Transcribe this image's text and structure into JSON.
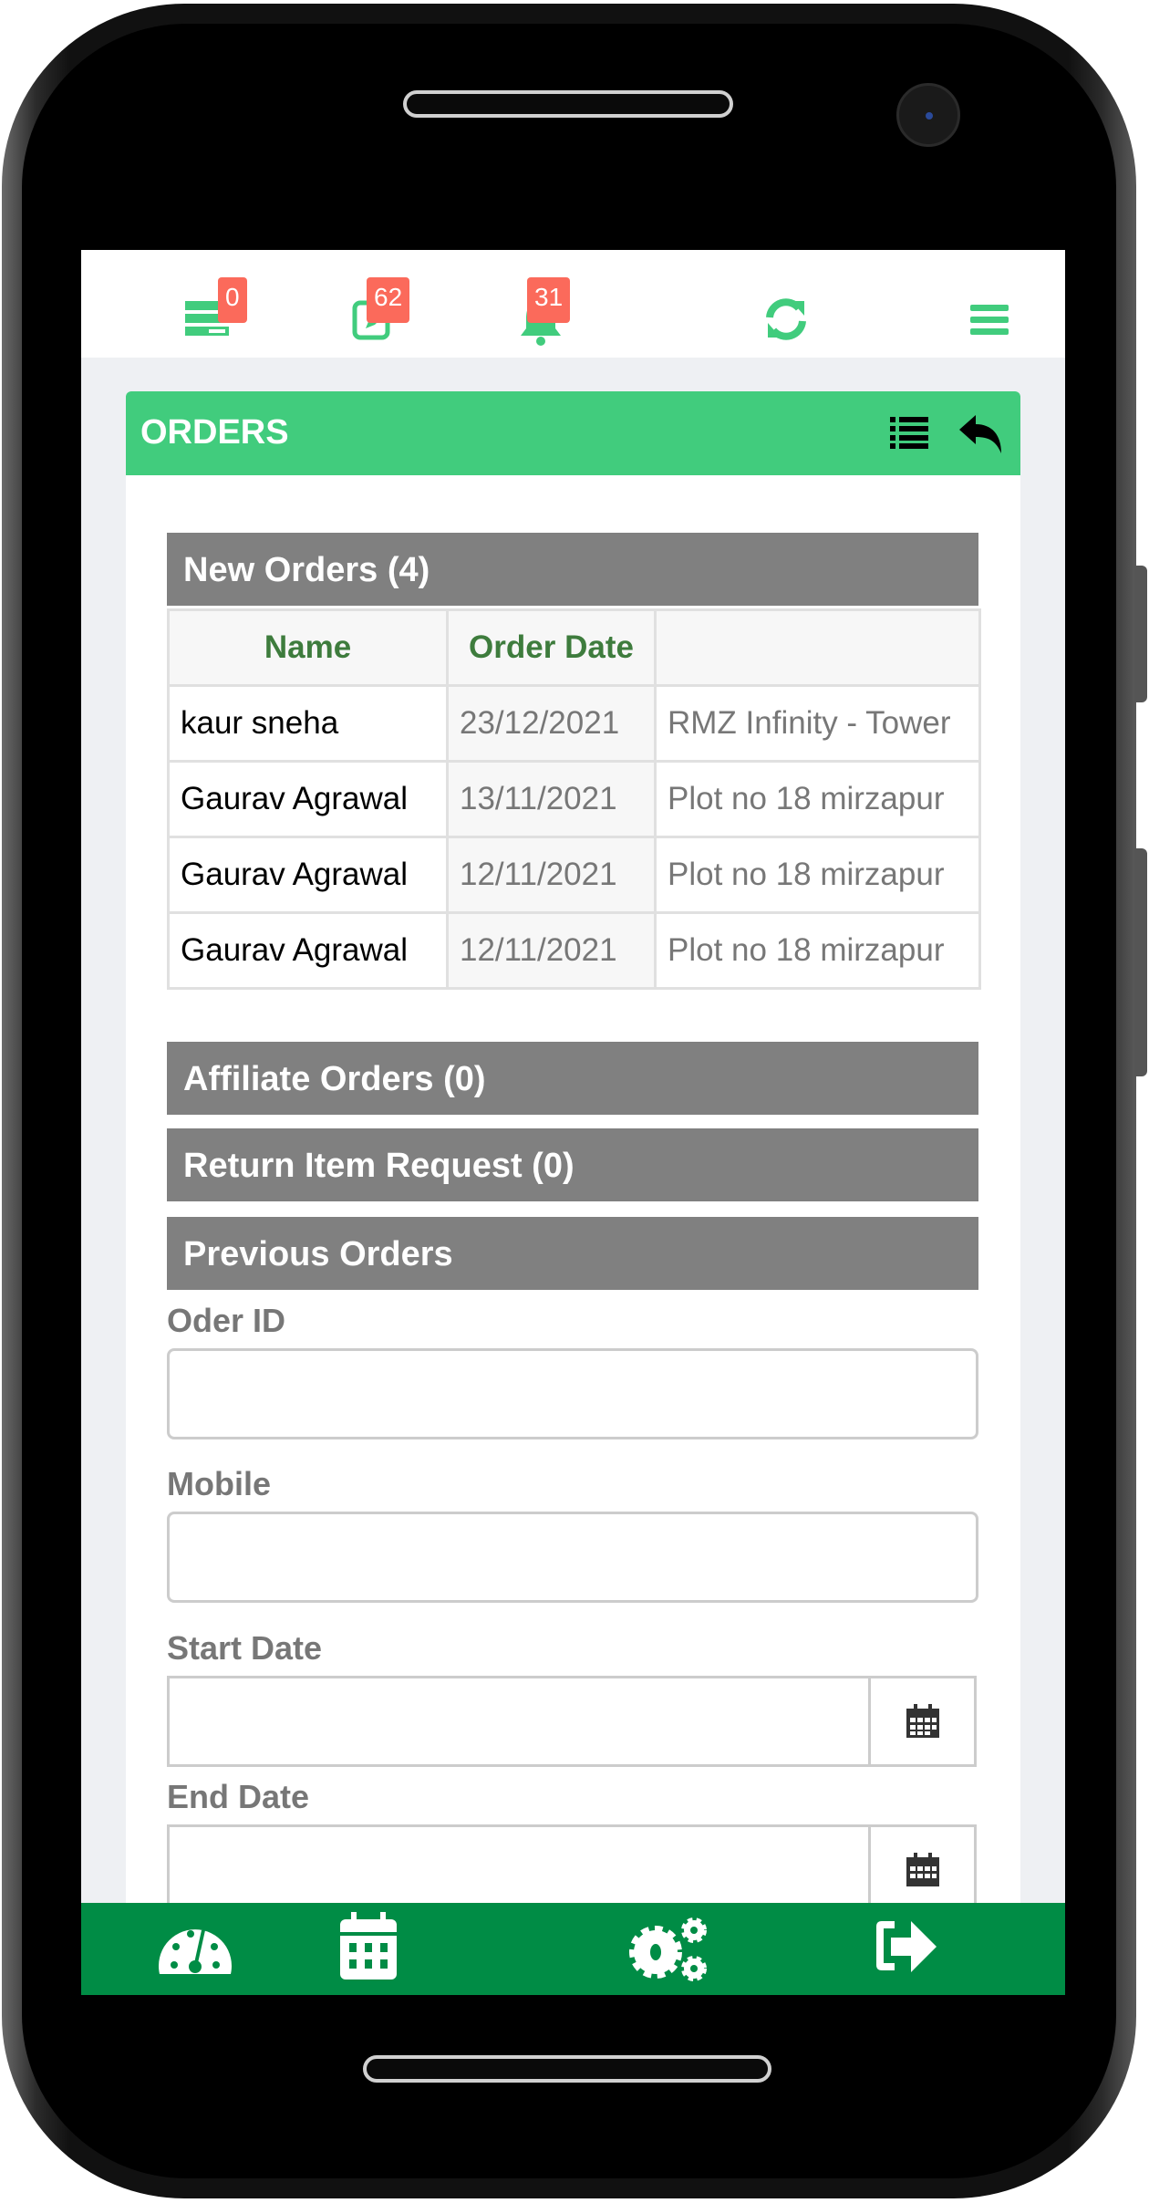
{
  "colors": {
    "accent": "#41cc7d",
    "badge": "#fb6a5b",
    "section": "#808080",
    "nav": "#008c45",
    "header_text": "#3e7c3d"
  },
  "topbar": {
    "items": [
      {
        "icon": "list-alt-icon",
        "badge": "0"
      },
      {
        "icon": "edit-square-icon",
        "badge": "62"
      },
      {
        "icon": "bell-icon",
        "badge": "31"
      },
      {
        "icon": "refresh-icon"
      },
      {
        "icon": "hamburger-menu-icon"
      }
    ]
  },
  "card": {
    "title": "ORDERS",
    "icons": [
      "list-icon",
      "reply-icon"
    ]
  },
  "new_orders": {
    "title": "New Orders (4)",
    "columns": [
      "Name",
      "Order Date",
      ""
    ],
    "rows": [
      [
        "kaur sneha",
        "23/12/2021",
        "RMZ Infinity - Tower"
      ],
      [
        "Gaurav Agrawal",
        "13/11/2021",
        "Plot no 18 mirzapur"
      ],
      [
        "Gaurav Agrawal",
        "12/11/2021",
        "Plot no 18 mirzapur"
      ],
      [
        "Gaurav Agrawal",
        "12/11/2021",
        "Plot no 18 mirzapur"
      ]
    ]
  },
  "sections": {
    "affiliate": "Affiliate Orders (0)",
    "return": "Return Item Request (0)",
    "previous": "Previous Orders"
  },
  "form": {
    "order_id": {
      "label": "Oder ID",
      "value": ""
    },
    "mobile": {
      "label": "Mobile",
      "value": ""
    },
    "start_date": {
      "label": "Start Date",
      "value": ""
    },
    "end_date": {
      "label": "End Date",
      "value": ""
    }
  },
  "bottom_nav": [
    "dashboard-icon",
    "calendar-icon",
    "settings-icon",
    "logout-icon"
  ]
}
